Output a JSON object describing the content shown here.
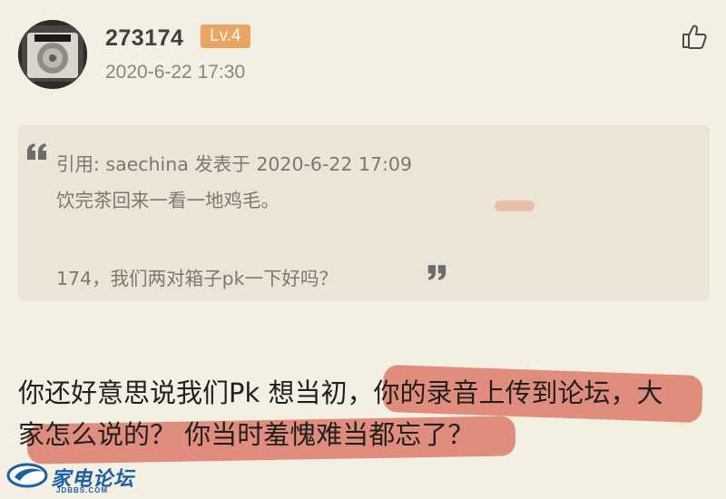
{
  "post": {
    "username": "273174",
    "level_badge": "Lv.4",
    "timestamp": "2020-6-22 17:30",
    "like_icon": "thumbs-up-icon",
    "quote": {
      "header": "引用: saechina 发表于 2020-6-22 17:09",
      "line1": "饮完茶回来一看一地鸡毛。",
      "line2": "174，我们两对箱子pk一下好吗？"
    },
    "reply": {
      "line1": "你还好意思说我们Pk 想当初，你的录音上传到论坛，大",
      "line2": "家怎么说的？ 你当时羞愧难当都忘了？"
    }
  },
  "watermark": {
    "brand": "家电论坛",
    "site": "JDBBS.COM"
  },
  "colors": {
    "background": "#f4efe3",
    "quote_background": "#ece5d7",
    "level_badge": "#eaa562",
    "highlight_strike": "#d96656",
    "watermark_blue": "#1e5ea6"
  }
}
